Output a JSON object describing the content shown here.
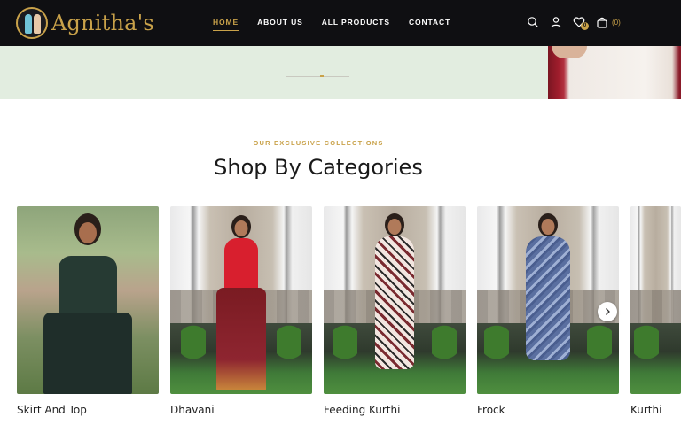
{
  "brand": {
    "name": "Agnitha's",
    "accent": "#c9a24a",
    "header_bg": "#0f0f12"
  },
  "nav": {
    "items": [
      {
        "label": "HOME",
        "active": true
      },
      {
        "label": "ABOUT US",
        "active": false
      },
      {
        "label": "ALL PRODUCTS",
        "active": false
      },
      {
        "label": "CONTACT",
        "active": false
      }
    ]
  },
  "header_tools": {
    "icons": [
      "search-icon",
      "user-icon",
      "heart-icon",
      "bag-icon"
    ],
    "wishlist_count": "0",
    "cart_count": "(0)"
  },
  "section": {
    "eyebrow": "OUR EXCLUSIVE COLLECTIONS",
    "title": "Shop By Categories"
  },
  "categories": [
    {
      "label": "Skirt And Top"
    },
    {
      "label": "Dhavani"
    },
    {
      "label": "Feeding Kurthi"
    },
    {
      "label": "Frock"
    },
    {
      "label": "Kurthi"
    }
  ],
  "carousel": {
    "next_icon": "chevron-right-icon"
  }
}
